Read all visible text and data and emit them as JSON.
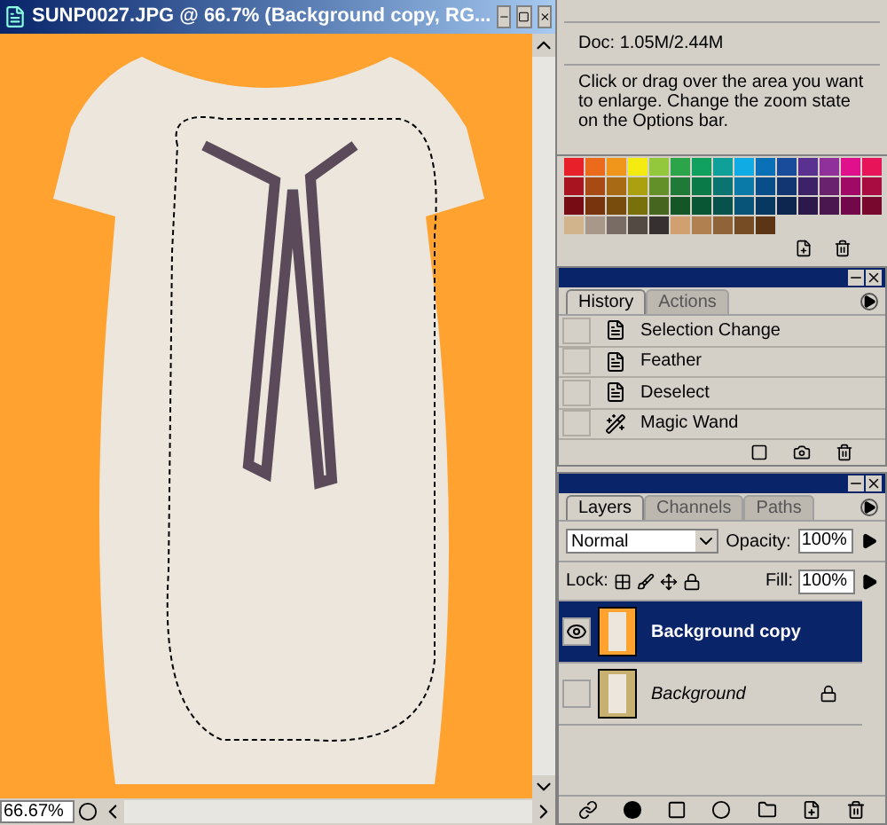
{
  "document": {
    "title": "SUNP0027.JPG @ 66.7% (Background copy, RG...",
    "zoom": "66.67%"
  },
  "info": {
    "doc": "Doc: 1.05M/2.44M",
    "hint": "Click or drag over the area you want to enlarge. Change the zoom state on the Options bar."
  },
  "swatches": [
    {
      "color": "#e8202a"
    },
    {
      "color": "#ec6a1c"
    },
    {
      "color": "#f0961a"
    },
    {
      "color": "#f4ec10"
    },
    {
      "color": "#94c83c"
    },
    {
      "color": "#2ca44a"
    },
    {
      "color": "#10a060"
    },
    {
      "color": "#10a09a"
    },
    {
      "color": "#10aae4"
    },
    {
      "color": "#0a70b8"
    },
    {
      "color": "#1a4c9c"
    },
    {
      "color": "#5a3090"
    },
    {
      "color": "#90309a"
    },
    {
      "color": "#e0108c"
    },
    {
      "color": "#e8145a"
    },
    {
      "color": "#a81420"
    },
    {
      "color": "#a84a14"
    },
    {
      "color": "#a86a14"
    },
    {
      "color": "#aaa010"
    },
    {
      "color": "#64902a"
    },
    {
      "color": "#1e7a36"
    },
    {
      "color": "#0a7a48"
    },
    {
      "color": "#0a7470"
    },
    {
      "color": "#0a7aa8"
    },
    {
      "color": "#084e88"
    },
    {
      "color": "#123672"
    },
    {
      "color": "#3e2268"
    },
    {
      "color": "#68226e"
    },
    {
      "color": "#a00a66"
    },
    {
      "color": "#a80c40"
    },
    {
      "color": "#780c14"
    },
    {
      "color": "#78340c"
    },
    {
      "color": "#784c0c"
    },
    {
      "color": "#78700a"
    },
    {
      "color": "#466620"
    },
    {
      "color": "#145626"
    },
    {
      "color": "#085634"
    },
    {
      "color": "#08524e"
    },
    {
      "color": "#085478"
    },
    {
      "color": "#063862"
    },
    {
      "color": "#0c2650"
    },
    {
      "color": "#2c184a"
    },
    {
      "color": "#4a184e"
    },
    {
      "color": "#72084a"
    },
    {
      "color": "#78082e"
    },
    {
      "color": "#d2b48c"
    },
    {
      "color": "#a8988a"
    },
    {
      "color": "#786c64"
    },
    {
      "color": "#544a44"
    },
    {
      "color": "#363030"
    },
    {
      "color": "#d0a070"
    },
    {
      "color": "#b08050"
    },
    {
      "color": "#906438"
    },
    {
      "color": "#764c24"
    },
    {
      "color": "#5c3614"
    }
  ],
  "history": {
    "tabs": [
      {
        "label": "History",
        "selected": true
      },
      {
        "label": "Actions",
        "selected": false
      }
    ],
    "items": [
      {
        "label": "Selection Change",
        "kind": "step",
        "source": false
      },
      {
        "label": "Feather",
        "kind": "step",
        "source": false
      },
      {
        "label": "Deselect",
        "kind": "step",
        "source": false
      },
      {
        "label": "Magic Wand",
        "kind": "tool",
        "source": false
      }
    ]
  },
  "layers": {
    "tabs": [
      {
        "label": "Layers",
        "selected": true
      },
      {
        "label": "Channels",
        "selected": false
      },
      {
        "label": "Paths",
        "selected": false
      }
    ],
    "blend_mode": "Normal",
    "opacity_label": "Opacity:",
    "opacity": "100%",
    "lock_label": "Lock:",
    "fill_label": "Fill:",
    "fill": "100%",
    "items": [
      {
        "name": "Background copy",
        "selected": true,
        "visible": true,
        "locked": false
      },
      {
        "name": "Background",
        "selected": false,
        "visible": false,
        "locked": true
      }
    ]
  }
}
